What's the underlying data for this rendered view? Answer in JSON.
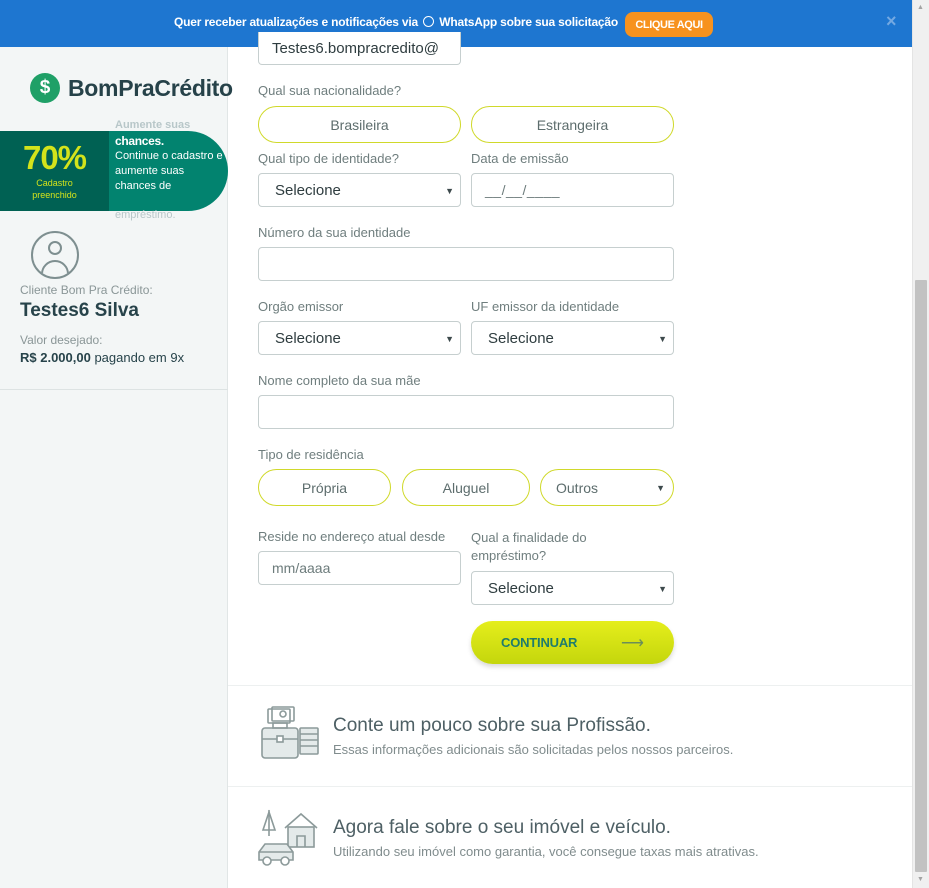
{
  "banner": {
    "text_before": "Quer receber atualizações e notificações via",
    "text_whatsapp": "WhatsApp sobre sua solicitação",
    "button": "CLIQUE AQUI",
    "close": "×"
  },
  "sidebar": {
    "logo_symbol": "$",
    "logo_text": "BomPraCrédito",
    "progress": {
      "percent": "70%",
      "percent_value": 70,
      "caption": "Cadastro preenchido",
      "ghost_top": "Aumente suas",
      "bold": "chances.",
      "body": "Continue o cadastro e aumente suas chances de",
      "ghost_bottom": "empréstimo."
    },
    "client_label": "Cliente Bom Pra Crédito:",
    "client_name": "Testes6 Silva",
    "value_label": "Valor desejado:",
    "value_amount": "R$ 2.000,00",
    "value_suffix": " pagando em 9x"
  },
  "form": {
    "email_value": "Testes6.bompracredito@",
    "nationality": {
      "label": "Qual sua nacionalidade?",
      "options": [
        "Brasileira",
        "Estrangeira"
      ]
    },
    "id_type": {
      "label": "Qual tipo de identidade?",
      "value": "Selecione"
    },
    "issue_date": {
      "label": "Data de emissão",
      "placeholder": "__/__/____"
    },
    "id_number": {
      "label": "Número da sua identidade",
      "value": ""
    },
    "issuer": {
      "label": "Orgão emissor",
      "value": "Selecione"
    },
    "issuer_uf": {
      "label": "UF emissor da identidade",
      "value": "Selecione"
    },
    "mother_name": {
      "label": "Nome completo da sua mãe",
      "value": ""
    },
    "residence": {
      "label": "Tipo de residência",
      "options": [
        "Própria",
        "Aluguel"
      ],
      "other": "Outros"
    },
    "since": {
      "label": "Reside no endereço atual desde",
      "placeholder": "mm/aaaa"
    },
    "purpose": {
      "label_line1": "Qual a finalidade do",
      "label_line2": "empréstimo?",
      "value": "Selecione"
    },
    "continue_button": "CONTINUAR"
  },
  "sections": [
    {
      "title": "Conte um pouco sobre sua Profissão.",
      "subtitle": "Essas informações adicionais são solicitadas pelos nossos parceiros.",
      "icon": "money-briefcase-icon"
    },
    {
      "title": "Agora fale sobre o seu imóvel e veículo.",
      "subtitle": "Utilizando seu imóvel como garantia, você consegue taxas mais atrativas.",
      "icon": "house-car-icon"
    }
  ],
  "colors": {
    "banner": "#1e76d0",
    "banner_button": "#f7921e",
    "brand_green": "#02836f",
    "accent_lime": "#d3e31b",
    "pill_border": "#d0d92b"
  }
}
